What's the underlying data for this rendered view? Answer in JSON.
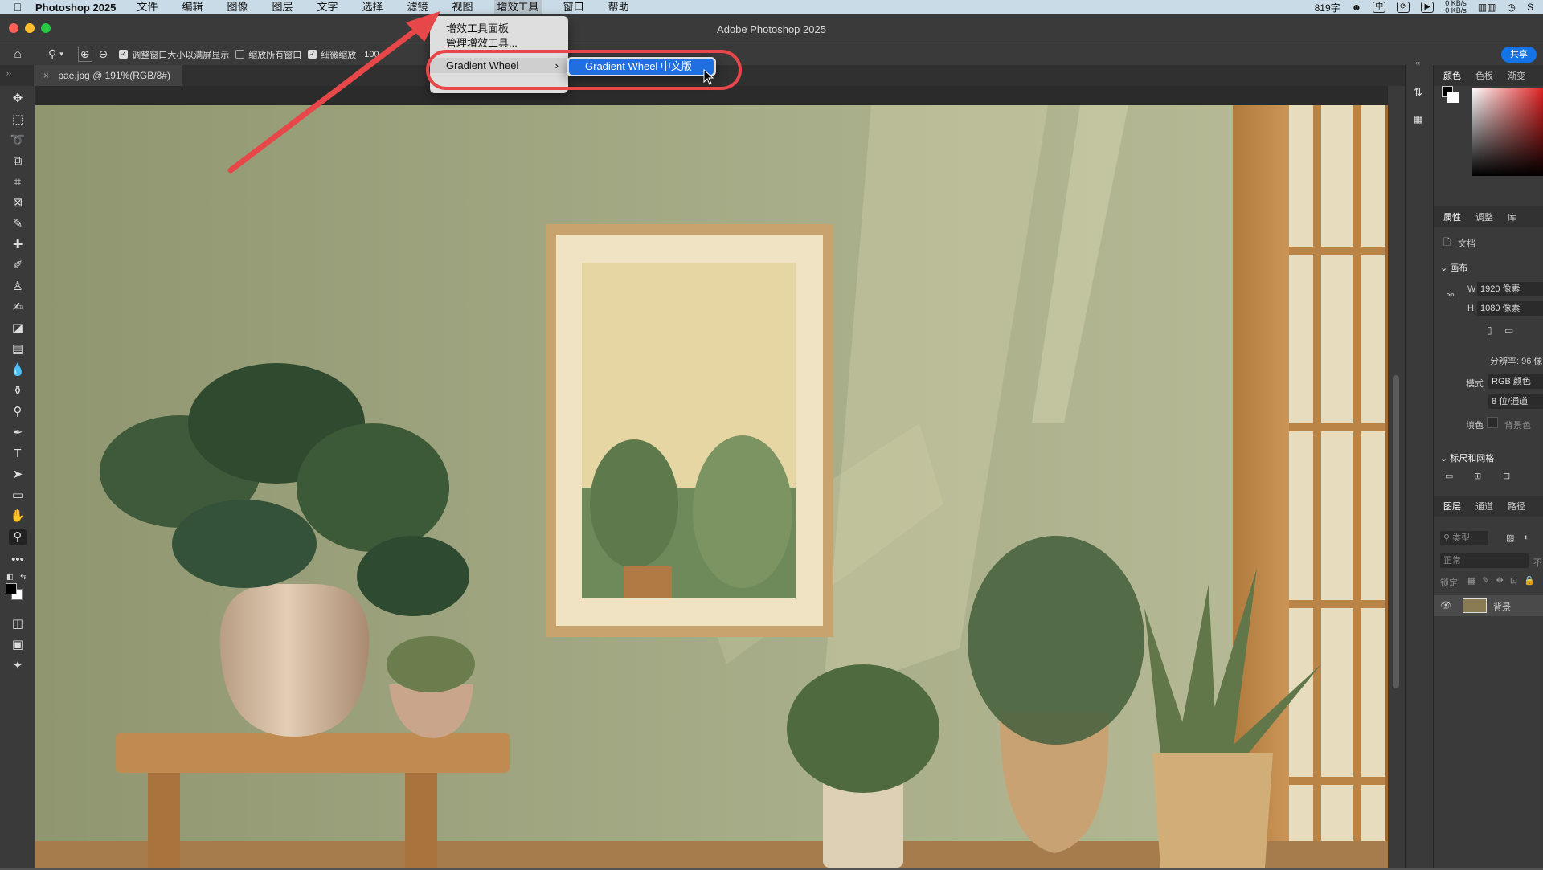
{
  "menubar": {
    "app": "Photoshop 2025",
    "items": [
      "文件",
      "编辑",
      "图像",
      "图层",
      "文字",
      "选择",
      "滤镜",
      "视图",
      "增效工具",
      "窗口",
      "帮助"
    ],
    "active_index": 8,
    "status_text": "819字",
    "net_up": "0 KB/s",
    "net_down": "0 KB/s"
  },
  "window": {
    "title": "Adobe Photoshop 2025"
  },
  "options": {
    "resize_label": "调整窗口大小以满屏显示",
    "zoom_all_label": "缩放所有窗口",
    "scrubby_label": "细微缩放",
    "percent": "100",
    "share_label": "共享"
  },
  "document_tab": {
    "label": "pae.jpg @ 191%(RGB/8#)"
  },
  "plugin_menu": {
    "items": [
      "增效工具面板",
      "管理增效工具...",
      "Gradient Wheel"
    ],
    "submenu_item": "Gradient Wheel 中文版"
  },
  "panels": {
    "color_tabs": [
      "颜色",
      "色板",
      "渐变"
    ],
    "prop_tabs": [
      "属性",
      "调整",
      "库"
    ],
    "doc_label": "文档",
    "canvas_section": "画布",
    "width_label": "W",
    "width_value": "1920 像素",
    "height_label": "H",
    "height_value": "1080 像素",
    "resolution": "分辨率: 96 像",
    "mode_label": "模式",
    "mode_value": "RGB 颜色",
    "bits_value": "8 位/通道",
    "fill_label": "填色",
    "fill_value": "背景色",
    "rulers_section": "标尺和网格",
    "layer_tabs": [
      "图层",
      "通道",
      "路径"
    ],
    "kind_placeholder": "类型",
    "blend_mode": "正常",
    "opacity_prefix": "不",
    "lock_label": "锁定:",
    "layer_name": "背景"
  }
}
